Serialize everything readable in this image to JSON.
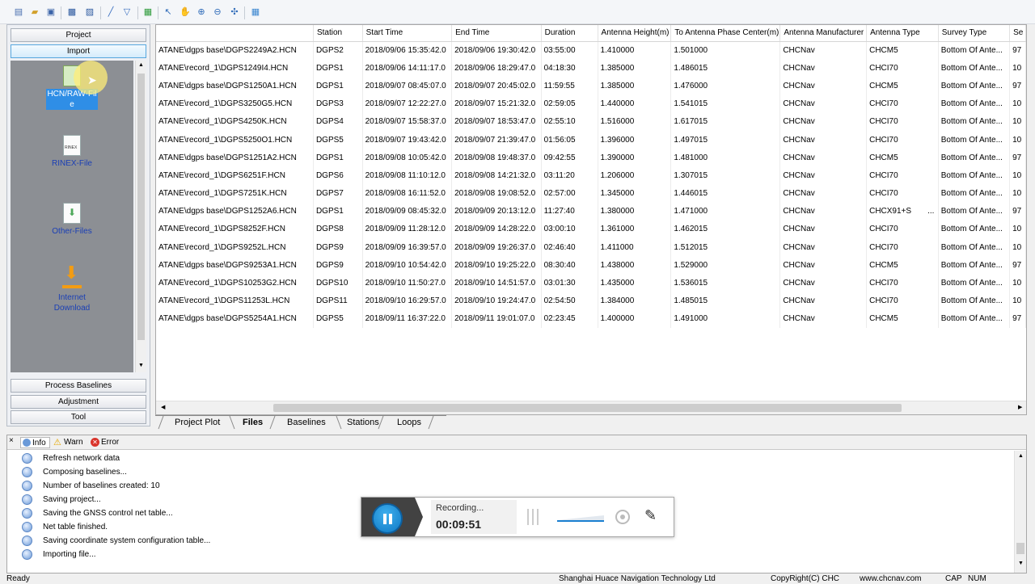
{
  "left_panel": {
    "project_label": "Project",
    "import_label": "Import",
    "items": [
      {
        "label": "HCN/RAW-File",
        "icon": "hcn-file-icon"
      },
      {
        "label": "RINEX-File",
        "icon": "rinex-file-icon"
      },
      {
        "label": "Other-Files",
        "icon": "other-files-icon"
      },
      {
        "label": "Internet Download",
        "icon": "download-icon"
      }
    ],
    "process_label": "Process Baselines",
    "adjustment_label": "Adjustment",
    "tool_label": "Tool"
  },
  "grid": {
    "columns": [
      "",
      "Station",
      "Start Time",
      "End Time",
      "Duration",
      "Antenna Height(m)",
      "To Antenna Phase Center(m)",
      "Antenna Manufacturer",
      "Antenna Type",
      "Survey Type",
      "Se"
    ],
    "rows": [
      [
        "ATANE\\dgps base\\DGPS2249A2.HCN",
        "DGPS2",
        "2018/09/06 15:35:42.0",
        "2018/09/06 19:30:42.0",
        "03:55:00",
        "1.410000",
        "1.501000",
        "CHCNav",
        "CHCM5",
        "Bottom Of Ante...",
        "97"
      ],
      [
        "ATANE\\record_1\\DGPS1249I4.HCN",
        "DGPS1",
        "2018/09/06 14:11:17.0",
        "2018/09/06 18:29:47.0",
        "04:18:30",
        "1.385000",
        "1.486015",
        "CHCNav",
        "CHCI70",
        "Bottom Of Ante...",
        "10"
      ],
      [
        "ATANE\\dgps base\\DGPS1250A1.HCN",
        "DGPS1",
        "2018/09/07 08:45:07.0",
        "2018/09/07 20:45:02.0",
        "11:59:55",
        "1.385000",
        "1.476000",
        "CHCNav",
        "CHCM5",
        "Bottom Of Ante...",
        "97"
      ],
      [
        "ATANE\\record_1\\DGPS3250G5.HCN",
        "DGPS3",
        "2018/09/07 12:22:27.0",
        "2018/09/07 15:21:32.0",
        "02:59:05",
        "1.440000",
        "1.541015",
        "CHCNav",
        "CHCI70",
        "Bottom Of Ante...",
        "10"
      ],
      [
        "ATANE\\record_1\\DGPS4250K.HCN",
        "DGPS4",
        "2018/09/07 15:58:37.0",
        "2018/09/07 18:53:47.0",
        "02:55:10",
        "1.516000",
        "1.617015",
        "CHCNav",
        "CHCI70",
        "Bottom Of Ante...",
        "10"
      ],
      [
        "ATANE\\record_1\\DGPS5250O1.HCN",
        "DGPS5",
        "2018/09/07 19:43:42.0",
        "2018/09/07 21:39:47.0",
        "01:56:05",
        "1.396000",
        "1.497015",
        "CHCNav",
        "CHCI70",
        "Bottom Of Ante...",
        "10"
      ],
      [
        "ATANE\\dgps base\\DGPS1251A2.HCN",
        "DGPS1",
        "2018/09/08 10:05:42.0",
        "2018/09/08 19:48:37.0",
        "09:42:55",
        "1.390000",
        "1.481000",
        "CHCNav",
        "CHCM5",
        "Bottom Of Ante...",
        "97"
      ],
      [
        "ATANE\\record_1\\DGPS6251F.HCN",
        "DGPS6",
        "2018/09/08 11:10:12.0",
        "2018/09/08 14:21:32.0",
        "03:11:20",
        "1.206000",
        "1.307015",
        "CHCNav",
        "CHCI70",
        "Bottom Of Ante...",
        "10"
      ],
      [
        "ATANE\\record_1\\DGPS7251K.HCN",
        "DGPS7",
        "2018/09/08 16:11:52.0",
        "2018/09/08 19:08:52.0",
        "02:57:00",
        "1.345000",
        "1.446015",
        "CHCNav",
        "CHCI70",
        "Bottom Of Ante...",
        "10"
      ],
      [
        "ATANE\\dgps base\\DGPS1252A6.HCN",
        "DGPS1",
        "2018/09/09 08:45:32.0",
        "2018/09/09 20:13:12.0",
        "11:27:40",
        "1.380000",
        "1.471000",
        "CHCNav",
        "CHCX91+S",
        "Bottom Of Ante...",
        "97"
      ],
      [
        "ATANE\\record_1\\DGPS8252F.HCN",
        "DGPS8",
        "2018/09/09 11:28:12.0",
        "2018/09/09 14:28:22.0",
        "03:00:10",
        "1.361000",
        "1.462015",
        "CHCNav",
        "CHCI70",
        "Bottom Of Ante...",
        "10"
      ],
      [
        "ATANE\\record_1\\DGPS9252L.HCN",
        "DGPS9",
        "2018/09/09 16:39:57.0",
        "2018/09/09 19:26:37.0",
        "02:46:40",
        "1.411000",
        "1.512015",
        "CHCNav",
        "CHCI70",
        "Bottom Of Ante...",
        "10"
      ],
      [
        "ATANE\\dgps base\\DGPS9253A1.HCN",
        "DGPS9",
        "2018/09/10 10:54:42.0",
        "2018/09/10 19:25:22.0",
        "08:30:40",
        "1.438000",
        "1.529000",
        "CHCNav",
        "CHCM5",
        "Bottom Of Ante...",
        "97"
      ],
      [
        "ATANE\\record_1\\DGPS10253G2.HCN",
        "DGPS10",
        "2018/09/10 11:50:27.0",
        "2018/09/10 14:51:57.0",
        "03:01:30",
        "1.435000",
        "1.536015",
        "CHCNav",
        "CHCI70",
        "Bottom Of Ante...",
        "10"
      ],
      [
        "ATANE\\record_1\\DGPS11253L.HCN",
        "DGPS11",
        "2018/09/10 16:29:57.0",
        "2018/09/10 19:24:47.0",
        "02:54:50",
        "1.384000",
        "1.485015",
        "CHCNav",
        "CHCI70",
        "Bottom Of Ante...",
        "10"
      ],
      [
        "ATANE\\dgps base\\DGPS5254A1.HCN",
        "DGPS5",
        "2018/09/11 16:37:22.0",
        "2018/09/11 19:01:07.0",
        "02:23:45",
        "1.400000",
        "1.491000",
        "CHCNav",
        "CHCM5",
        "Bottom Of Ante...",
        "97"
      ]
    ],
    "ellipsis": "..."
  },
  "tabs": [
    "Project Plot",
    "Files",
    "Baselines",
    "Stations",
    "Loops"
  ],
  "active_tab": "Files",
  "log": {
    "tabs": [
      "Info",
      "Warn",
      "Error"
    ],
    "lines": [
      "Refresh network data",
      "Composing baselines...",
      "Number of baselines created: 10",
      "Saving project...",
      "Saving the GNSS control net table...",
      "Net table finished.",
      "Saving coordinate system configuration table...",
      "Importing file..."
    ]
  },
  "status": {
    "left": "Ready",
    "company": "Shanghai Huace Navigation Technology Ltd",
    "copyright": "CopyRight(C) CHC",
    "website": "www.chcnav.com",
    "cap": "CAP",
    "num": "NUM"
  },
  "recorder": {
    "status": "Recording...",
    "time": "00:09:51"
  },
  "colors": {
    "accent": "#1a7fd0",
    "link": "#1a3fb5",
    "import_area": "#8c8f94"
  }
}
